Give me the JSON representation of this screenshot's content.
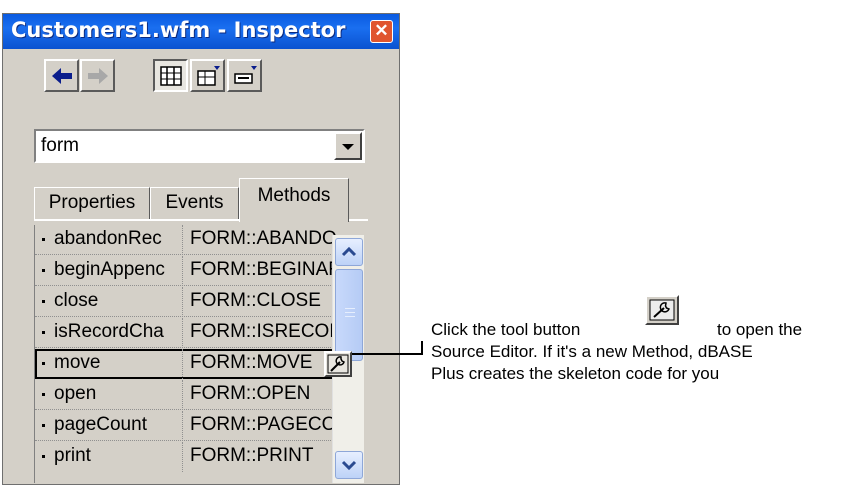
{
  "window": {
    "title": "Customers1.wfm - Inspector",
    "close_glyph": "✕"
  },
  "toolbar": {
    "buttons": [
      {
        "name": "back-button",
        "icon": "arrow-left-icon"
      },
      {
        "name": "forward-button",
        "icon": "arrow-right-icon"
      },
      {
        "name": "categorized-view-button",
        "icon": "grid-icon"
      },
      {
        "name": "object-properties-button",
        "icon": "object-icon"
      },
      {
        "name": "object-inspector-button",
        "icon": "object-icon"
      }
    ]
  },
  "object_selector": {
    "value": "form"
  },
  "tabs": [
    {
      "label": "Properties",
      "active": false
    },
    {
      "label": "Events",
      "active": false
    },
    {
      "label": "Methods",
      "active": true
    }
  ],
  "methods": [
    {
      "name": "abandonRec",
      "value": "FORM::ABANDO"
    },
    {
      "name": "beginAppenc",
      "value": "FORM::BEGINAF"
    },
    {
      "name": "close",
      "value": "FORM::CLOSE"
    },
    {
      "name": "isRecordCha",
      "value": "FORM::ISRECOF"
    },
    {
      "name": "move",
      "value": "FORM::MOVE",
      "selected": true
    },
    {
      "name": "open",
      "value": "FORM::OPEN"
    },
    {
      "name": "pageCount",
      "value": "FORM::PAGECO"
    },
    {
      "name": "print",
      "value": "FORM::PRINT"
    }
  ],
  "callout": {
    "line1_before": "Click the tool button",
    "line1_after": "to open the",
    "line2": "Source Editor. If it's a new Method, dBASE",
    "line3": "Plus creates the skeleton code for you"
  },
  "colors": {
    "title_bar": "#0a5ae0",
    "face": "#d4d0c8",
    "scroll_accent": "#bdd2f7"
  }
}
